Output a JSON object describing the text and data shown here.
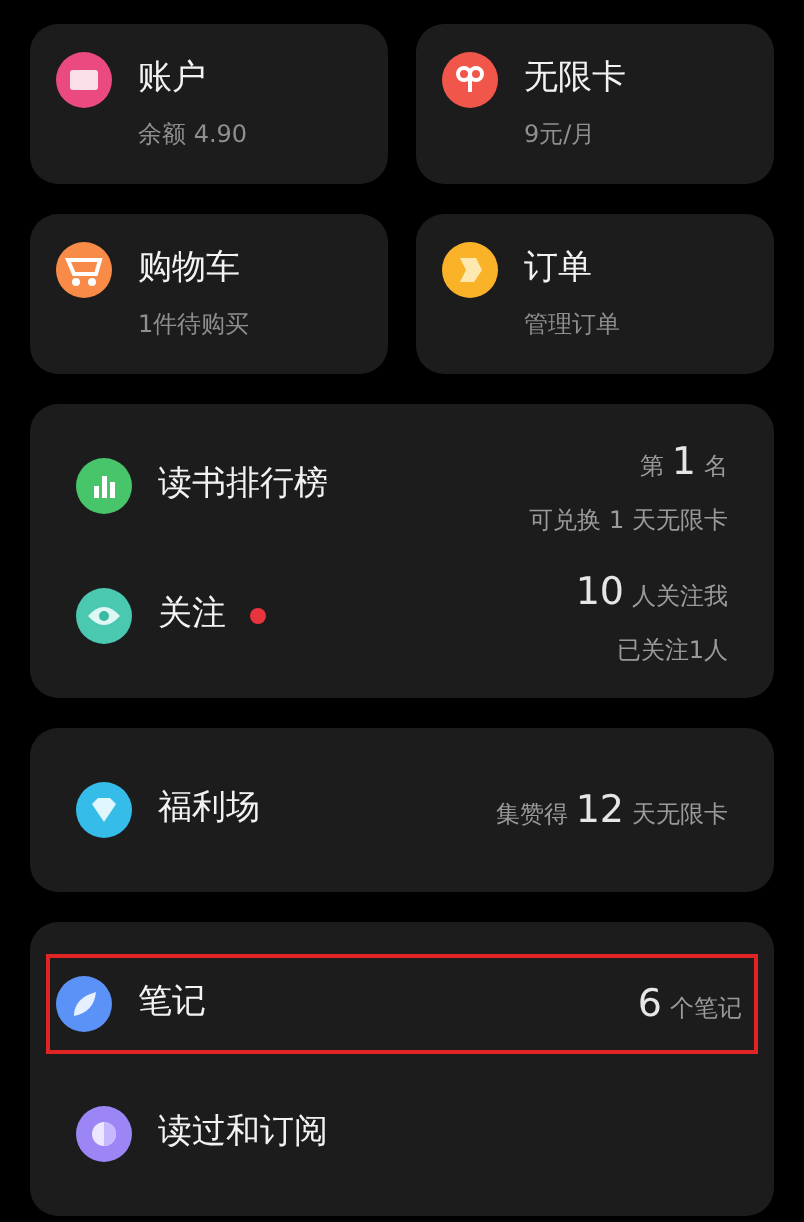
{
  "tiles": [
    {
      "kind": "wallet",
      "title": "账户",
      "subtitle": "余额 4.90"
    },
    {
      "kind": "card",
      "title": "无限卡",
      "subtitle": "9元/月"
    },
    {
      "kind": "cart",
      "title": "购物车",
      "subtitle": "1件待购买"
    },
    {
      "kind": "order",
      "title": "订单",
      "subtitle": "管理订单"
    }
  ],
  "groups": [
    {
      "rows": [
        {
          "kind": "rank",
          "title": "读书排行榜",
          "dot": false,
          "highlighted": false,
          "lines": [
            [
              {
                "text": "第",
                "big": false
              },
              {
                "text": "1",
                "big": true
              },
              {
                "text": "名",
                "big": false
              }
            ],
            [
              {
                "text": "可兑换 1 天无限卡",
                "big": false
              }
            ]
          ]
        },
        {
          "kind": "follow",
          "title": "关注",
          "dot": true,
          "highlighted": false,
          "lines": [
            [
              {
                "text": "10",
                "big": true
              },
              {
                "text": "人关注我",
                "big": false
              }
            ],
            [
              {
                "text": "已关注1人",
                "big": false
              }
            ]
          ]
        }
      ]
    },
    {
      "rows": [
        {
          "kind": "welfare",
          "title": "福利场",
          "dot": false,
          "highlighted": false,
          "lines": [
            [
              {
                "text": "集赞得",
                "big": false
              },
              {
                "text": "12",
                "big": true
              },
              {
                "text": "天无限卡",
                "big": false
              }
            ]
          ]
        }
      ]
    },
    {
      "rows": [
        {
          "kind": "note",
          "title": "笔记",
          "dot": false,
          "highlighted": true,
          "lines": [
            [
              {
                "text": "6",
                "big": true
              },
              {
                "text": "个笔记",
                "big": false
              }
            ]
          ]
        },
        {
          "kind": "read",
          "title": "读过和订阅",
          "dot": false,
          "highlighted": false,
          "lines": []
        }
      ]
    }
  ]
}
